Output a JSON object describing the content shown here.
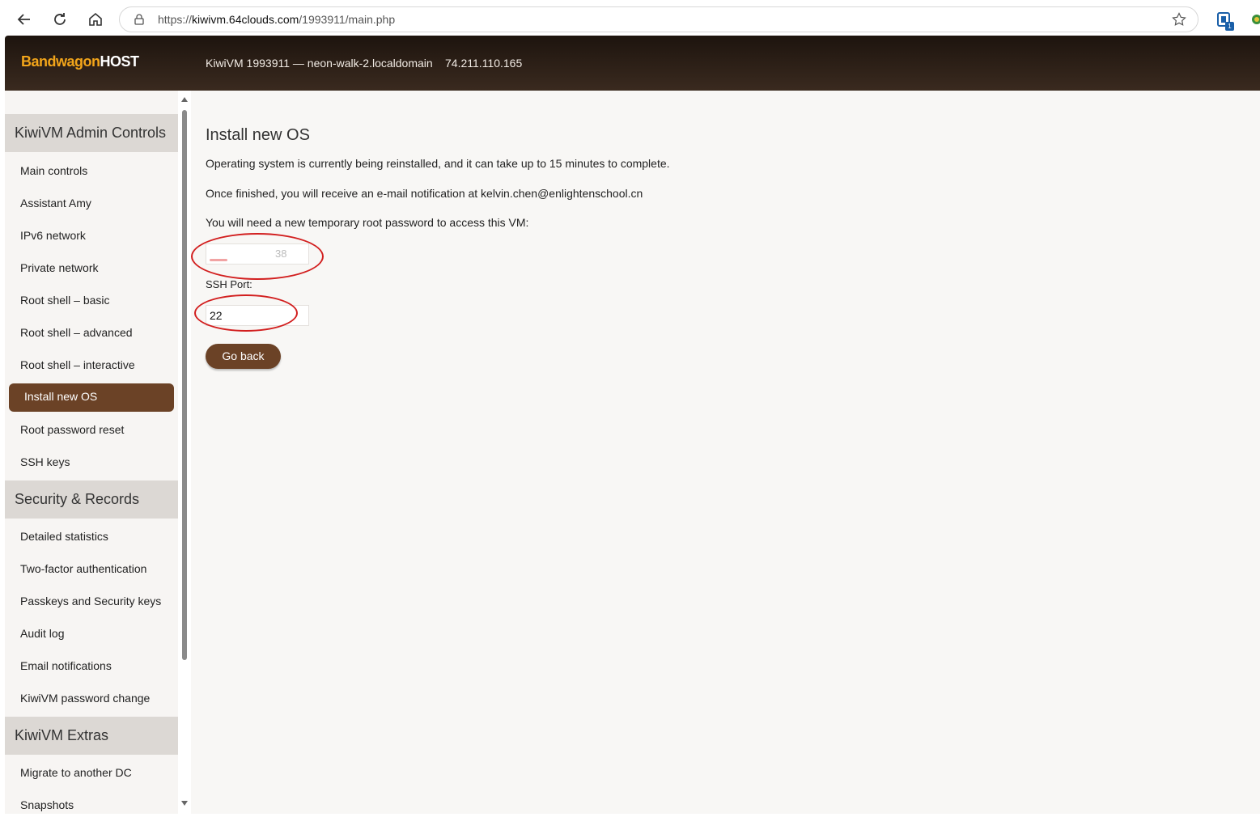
{
  "browser": {
    "url_prefix": "https://",
    "url_domain": "kiwivm.64clouds.com",
    "url_path": "/1993911/main.php",
    "extension_badge": "1"
  },
  "header": {
    "logo_part1": "Bandwagon",
    "logo_part2": "HOST",
    "vm_info": "KiwiVM 1993911 — neon-walk-2.localdomain",
    "ip": "74.211.110.165"
  },
  "sidebar": {
    "section1": "KiwiVM Admin Controls",
    "admin_items": [
      "Main controls",
      "Assistant Amy",
      "IPv6 network",
      "Private network",
      "Root shell – basic",
      "Root shell – advanced",
      "Root shell – interactive",
      "Install new OS",
      "Root password reset",
      "SSH keys"
    ],
    "active_item": "Install new OS",
    "section2": "Security & Records",
    "security_items": [
      "Detailed statistics",
      "Two-factor authentication",
      "Passkeys and Security keys",
      "Audit log",
      "Email notifications",
      "KiwiVM password change"
    ],
    "section3": "KiwiVM Extras",
    "extras_items": [
      "Migrate to another DC",
      "Snapshots"
    ]
  },
  "main": {
    "title": "Install new OS",
    "line1": "Operating system is currently being reinstalled, and it can take up to 15 minutes to complete.",
    "line2": "Once finished, you will receive an e-mail notification at kelvin.chen@enlightenschool.cn",
    "line3": "You will need a new temporary root password to access this VM:",
    "password_visible_fragment": "38",
    "ssh_label": "SSH Port:",
    "ssh_port": "22",
    "go_back": "Go back"
  },
  "colors": {
    "brand_brown": "#6b4226",
    "logo_orange": "#f2a51a",
    "annotation_red": "#d21f1f"
  }
}
